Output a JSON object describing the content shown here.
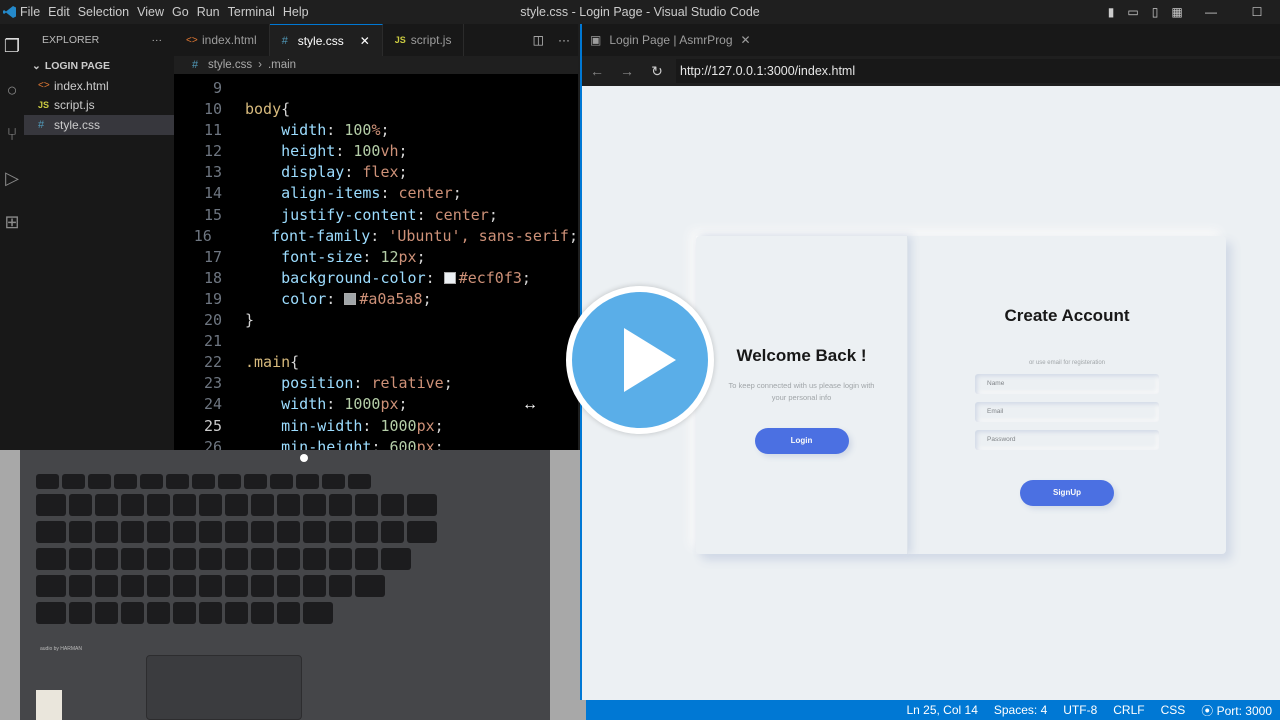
{
  "window": {
    "title": "style.css - Login Page - Visual Studio Code",
    "menu": [
      "File",
      "Edit",
      "Selection",
      "View",
      "Go",
      "Run",
      "Terminal",
      "Help"
    ]
  },
  "explorer": {
    "header": "EXPLORER",
    "folder": "LOGIN PAGE",
    "files": [
      {
        "name": "index.html",
        "type": "html"
      },
      {
        "name": "script.js",
        "type": "js"
      },
      {
        "name": "style.css",
        "type": "css"
      }
    ]
  },
  "editor": {
    "tabs": [
      "index.html",
      "style.css",
      "script.js"
    ],
    "active_tab": "style.css",
    "breadcrumb": [
      "style.css",
      ".main"
    ]
  },
  "code_lines": [
    {
      "n": "9",
      "t": ""
    },
    {
      "n": "10",
      "t": "body{"
    },
    {
      "n": "11",
      "t": "    width: 100%;"
    },
    {
      "n": "12",
      "t": "    height: 100vh;"
    },
    {
      "n": "13",
      "t": "    display: flex;"
    },
    {
      "n": "14",
      "t": "    align-items: center;"
    },
    {
      "n": "15",
      "t": "    justify-content: center;"
    },
    {
      "n": "16",
      "t": "    font-family: 'Ubuntu', sans-serif;"
    },
    {
      "n": "17",
      "t": "    font-size: 12px;"
    },
    {
      "n": "18",
      "t": "    background-color: #ecf0f3;"
    },
    {
      "n": "19",
      "t": "    color: #a0a5a8;"
    },
    {
      "n": "20",
      "t": "}"
    },
    {
      "n": "21",
      "t": ""
    },
    {
      "n": "22",
      "t": ".main{"
    },
    {
      "n": "23",
      "t": "    position: relative;"
    },
    {
      "n": "24",
      "t": "    width: 1000px;"
    },
    {
      "n": "25",
      "t": "    min-width: 1000px;"
    },
    {
      "n": "26",
      "t": "    min-height: 600px;"
    }
  ],
  "browser": {
    "tab_title": "Login Page | AsmrProg",
    "url": "http://127.0.0.1:3000/index.html"
  },
  "page": {
    "welcome_title": "Welcome Back !",
    "welcome_text": "To keep connected with us please login with your personal info",
    "login_button": "Login",
    "create_title": "Create Account",
    "create_sub": "or use email for registeration",
    "name_placeholder": "Name",
    "email_placeholder": "Email",
    "password_placeholder": "Password",
    "signup_button": "SignUp"
  },
  "keyboard": {
    "brand": "audio by HARMAN"
  },
  "status": {
    "position": "Ln 25, Col 14",
    "spaces": "Spaces: 4",
    "encoding": "UTF-8",
    "eol": "CRLF",
    "language": "CSS",
    "port": "Port: 3000"
  },
  "colors": {
    "accent": "#0078d4",
    "page_bg": "#ecf0f3",
    "button": "#4b70e2",
    "play": "#5aaee8"
  }
}
